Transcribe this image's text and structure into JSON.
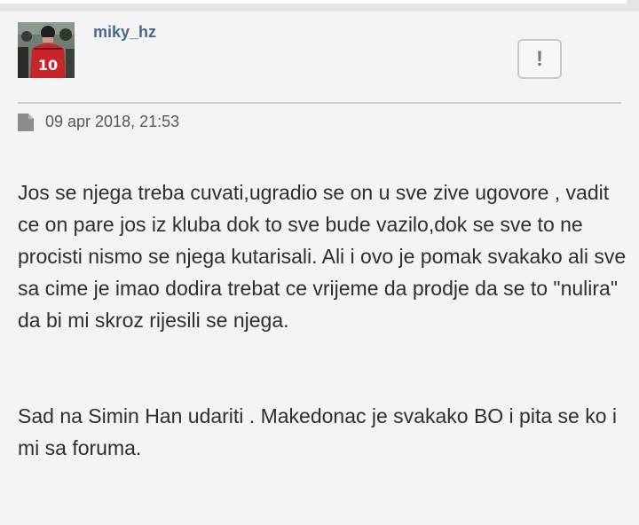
{
  "post": {
    "author": "miky_hz",
    "report_symbol": "!",
    "date": "09 apr 2018, 21:53",
    "paragraphs": [
      "Jos se njega treba cuvati,ugradio se on u sve zive ugovore , vadit ce on pare jos iz kluba dok to sve bude vazilo,dok se sve to ne procisti nismo se njega kutarisali. Ali i ovo je pomak svakako ali sve sa cime je imao dodira trebat ce vrijeme da prodje da se to \"nulira\" da bi mi skroz rijesili se njega.",
      "Sad na Simin Han udariti . Makedonac je svakako BO i pita se ko i mi sa foruma."
    ],
    "avatar": {
      "icon": "user-avatar",
      "shirt_number": "10",
      "colors": {
        "shirt": "#c8242b",
        "background": "#6f7d72"
      }
    },
    "icons": {
      "report": "exclamation-icon",
      "date": "document-icon"
    }
  },
  "colors": {
    "username": "#45698e",
    "post_background": "#f4f4f4",
    "page_background": "#e4e5e7",
    "text": "#2e2e2e"
  }
}
